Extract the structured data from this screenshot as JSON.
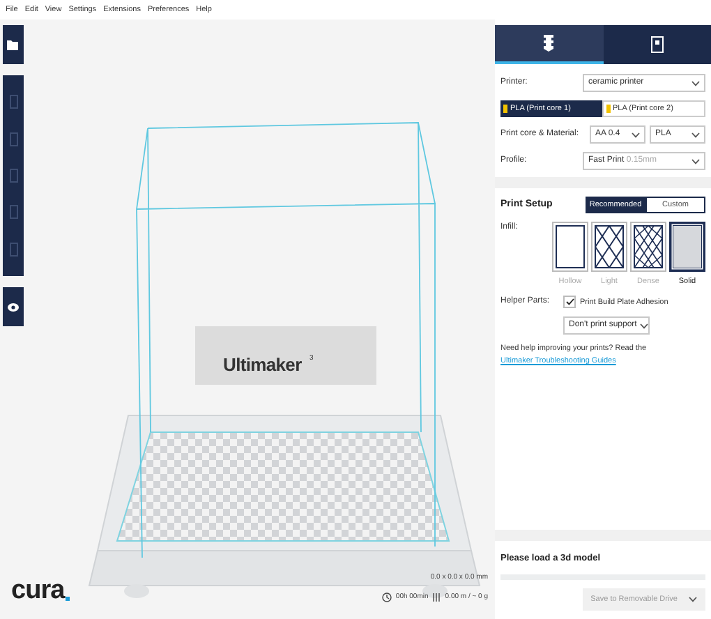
{
  "menu": [
    "File",
    "Edit",
    "View",
    "Settings",
    "Extensions",
    "Preferences",
    "Help"
  ],
  "sidebar_tabs": [
    {
      "selected": true
    },
    {
      "selected": false
    }
  ],
  "printer": {
    "label": "Printer:",
    "value": "ceramic printer"
  },
  "extruders": [
    {
      "label": "PLA (Print core 1)",
      "selected": true,
      "color": "#f2c200"
    },
    {
      "label": "PLA (Print core 2)",
      "selected": false,
      "color": "#f2c200"
    }
  ],
  "print_core": {
    "label": "Print core & Material:",
    "core": "AA 0.4",
    "material": "PLA"
  },
  "profile": {
    "label": "Profile:",
    "value": "Fast Print",
    "detail": "0.15mm"
  },
  "print_setup": {
    "title": "Print Setup",
    "modes": [
      {
        "label": "Recommended",
        "selected": true
      },
      {
        "label": "Custom",
        "selected": false
      }
    ]
  },
  "infill": {
    "label": "Infill:",
    "options": [
      {
        "kind": "hollow",
        "label": "Hollow",
        "selected": false
      },
      {
        "kind": "light",
        "label": "Light",
        "selected": false
      },
      {
        "kind": "dense",
        "label": "Dense",
        "selected": false
      },
      {
        "kind": "solid",
        "label": "Solid",
        "selected": true
      }
    ]
  },
  "helper": {
    "label": "Helper Parts:",
    "adhesion": {
      "label": "Print Build Plate Adhesion",
      "checked": true
    },
    "support": "Don't print support"
  },
  "help": {
    "text": "Need help improving your prints? Read the",
    "link": "Ultimaker Troubleshooting Guides"
  },
  "viewport": {
    "plate_brand": "Ultimaker",
    "plate_sup": "3",
    "dimensions": "0.0 x 0.0 x 0.0 mm",
    "time": "00h 00min",
    "material": "0.00 m / ~ 0 g"
  },
  "logo": "cura",
  "status": {
    "message": "Please load a 3d model",
    "level": 0,
    "save": "Save to Removable Drive"
  }
}
